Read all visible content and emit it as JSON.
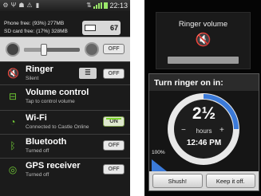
{
  "left_screen": {
    "status_bar": {
      "time": "22:13",
      "icons": [
        "settings-gear-icon",
        "usb-icon",
        "android-icon",
        "warning-icon",
        "sdcard-icon"
      ]
    },
    "storage": {
      "phone": "Phone free: (93%) 277MB",
      "sdcard": "SD card free: (17%) 328MB"
    },
    "battery": {
      "level": "67"
    },
    "brightness": {
      "toggle": "OFF",
      "level_fraction": 0.35
    },
    "items": [
      {
        "title": "Ringer",
        "subtitle": "Silent",
        "toggle": "OFF",
        "icon": "speaker-muted-icon"
      },
      {
        "title": "Volume control",
        "subtitle": "Tap to control volume",
        "toggle": "",
        "icon": "sliders-icon"
      },
      {
        "title": "Wi-Fi",
        "subtitle": "Connected to Castle Online",
        "toggle": "ON",
        "icon": "wifi-icon"
      },
      {
        "title": "Bluetooth",
        "subtitle": "Turned off",
        "toggle": "OFF",
        "icon": "bluetooth-icon"
      },
      {
        "title": "GPS receiver",
        "subtitle": "Turned off",
        "toggle": "OFF",
        "icon": "gps-icon"
      }
    ]
  },
  "right_screen": {
    "ringer_dialog": {
      "title": "Ringer volume",
      "icon": "speaker-muted-icon"
    },
    "turn_on_dialog": {
      "title": "Turn ringer on in:",
      "amount_whole": "2",
      "amount_fraction": "½",
      "unit": "hours",
      "time": "12:46 PM",
      "minus": "−",
      "plus": "+",
      "percent": "100%",
      "progress_fraction": 0.25,
      "buttons": [
        "Shush!",
        "Keep it off."
      ]
    }
  },
  "colors": {
    "accent_green": "#6fc735",
    "dial_blue": "#3b7ad9"
  }
}
